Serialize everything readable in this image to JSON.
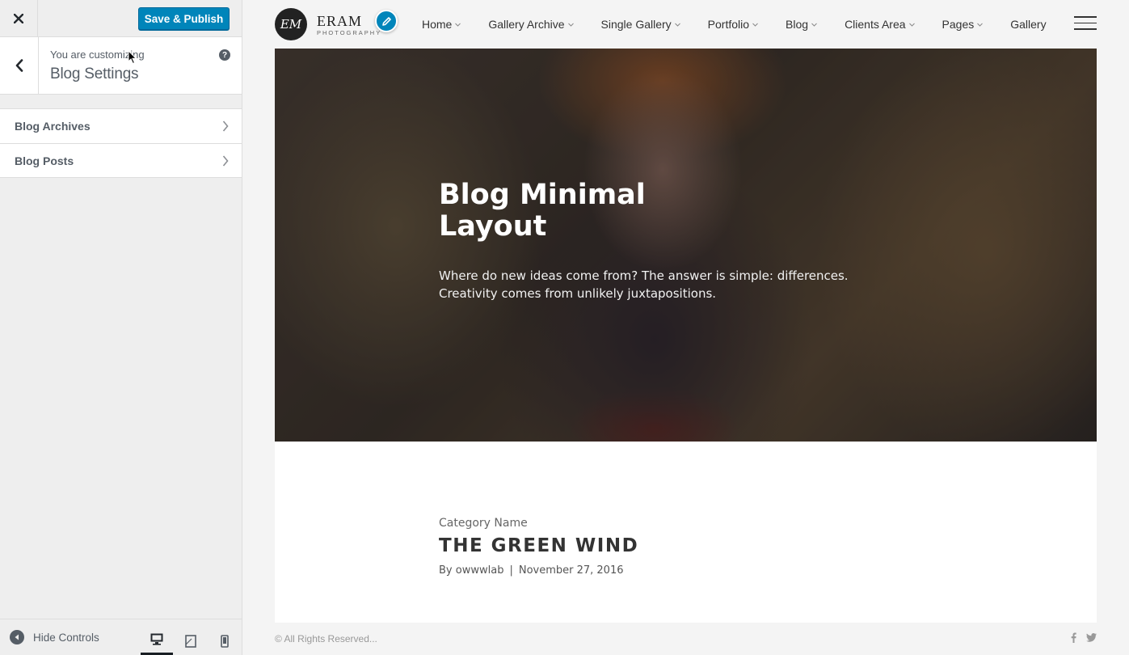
{
  "customizer": {
    "publish_label": "Save & Publish",
    "customizing_label": "You are customizing",
    "current_section": "Blog Settings",
    "panels": [
      {
        "label": "Blog Archives"
      },
      {
        "label": "Blog Posts"
      }
    ],
    "hide_controls_label": "Hide Controls",
    "devices": [
      "desktop",
      "tablet",
      "mobile"
    ],
    "active_device": "desktop",
    "accent_color": "#0085ba"
  },
  "site": {
    "logo_mark": "EM",
    "logo_name": "ERAM",
    "logo_tagline": "PHOTOGRAPHY",
    "nav": [
      {
        "label": "Home",
        "dropdown": true
      },
      {
        "label": "Gallery Archive",
        "dropdown": true
      },
      {
        "label": "Single Gallery",
        "dropdown": true
      },
      {
        "label": "Portfolio",
        "dropdown": true
      },
      {
        "label": "Blog",
        "dropdown": true
      },
      {
        "label": "Clients Area",
        "dropdown": true
      },
      {
        "label": "Pages",
        "dropdown": true
      },
      {
        "label": "Gallery",
        "dropdown": false
      }
    ],
    "hero": {
      "title": "Blog Minimal Layout",
      "subtitle": "Where do new ideas come from? The answer is simple: differences. Creativity comes from unlikely juxtapositions."
    },
    "post": {
      "category": "Category Name",
      "title": "THE GREEN WIND",
      "author_prefix": "By",
      "author": "owwwlab",
      "separator": "|",
      "date": "November 27, 2016"
    },
    "footer": {
      "copyright": "© All Rights Reserved...",
      "social": [
        "facebook-icon",
        "twitter-icon"
      ]
    }
  }
}
